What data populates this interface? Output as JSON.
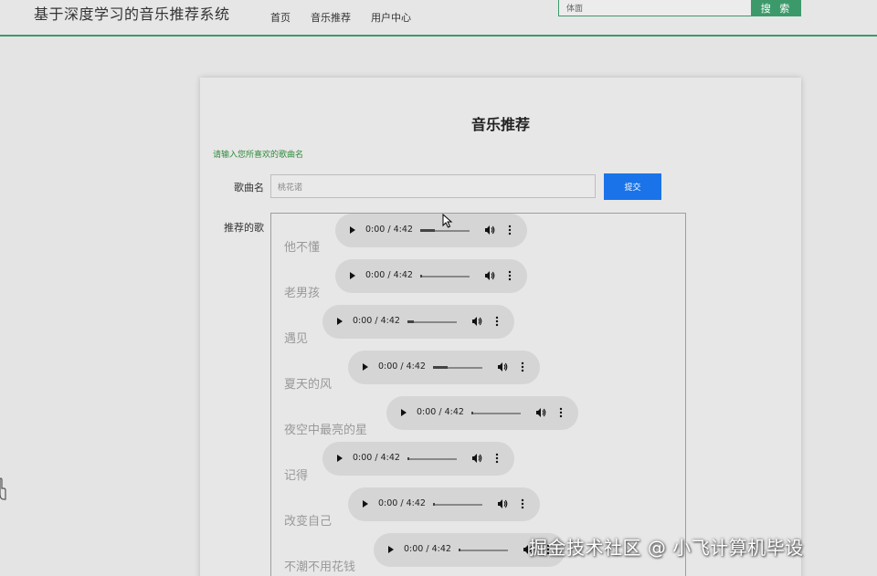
{
  "header": {
    "site_title": "基于深度学习的音乐推荐系统",
    "nav": [
      "首页",
      "音乐推荐",
      "用户中心"
    ],
    "search_value": "体面",
    "search_button": "搜 索"
  },
  "page": {
    "title": "音乐推荐",
    "hint": "请输入您所喜欢的歌曲名",
    "song_label": "歌曲名",
    "song_input_value": "桃花诺",
    "submit_label": "提交",
    "recommend_label": "推荐的歌"
  },
  "player_time": "0:00 / 4:42",
  "songs": [
    {
      "name": "他不懂",
      "progress": 0.3
    },
    {
      "name": "老男孩",
      "progress": 0.02
    },
    {
      "name": "遇见",
      "progress": 0.13
    },
    {
      "name": "夏天的风",
      "progress": 0.3
    },
    {
      "name": "夜空中最亮的星",
      "progress": 0.0
    },
    {
      "name": "记得",
      "progress": 0.0
    },
    {
      "name": "改变自己",
      "progress": 0.0
    },
    {
      "name": "不潮不用花钱",
      "progress": 0.0
    }
  ],
  "watermark": "掘金技术社区 @ 小飞计算机毕设",
  "colors": {
    "accent": "#3c9a6a",
    "submit": "#1a73e8",
    "hint": "#2f8a3a"
  }
}
